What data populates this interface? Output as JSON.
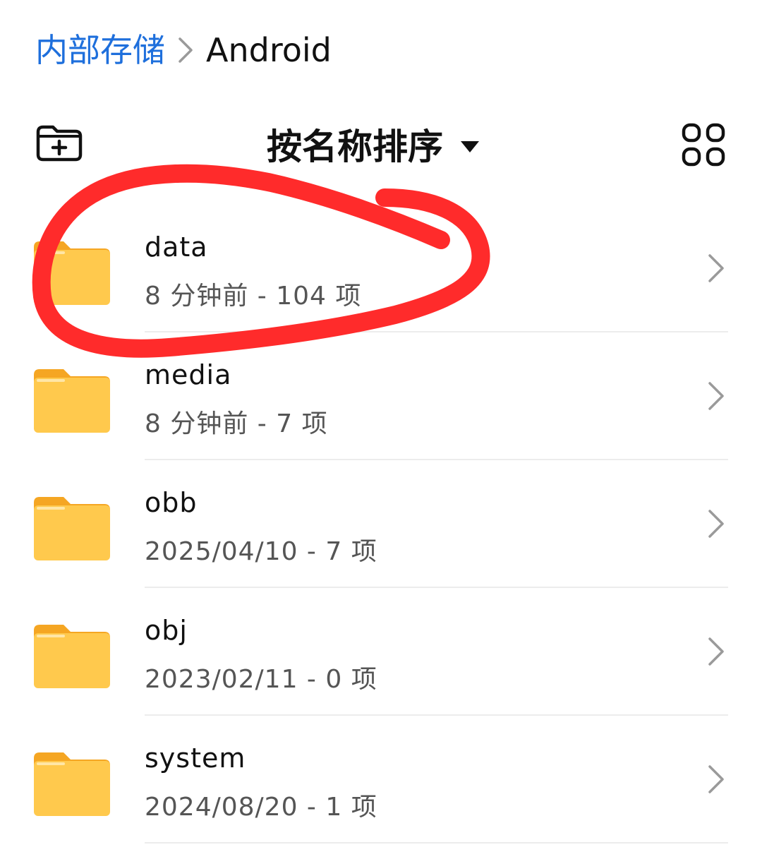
{
  "breadcrumb": {
    "root": "内部存储",
    "current": "Android"
  },
  "toolbar": {
    "sort_label": "按名称排序"
  },
  "icons": {
    "breadcrumb_separator": "chevron-right-icon",
    "new_folder": "new-folder-icon",
    "sort_dropdown": "caret-down-icon",
    "view_toggle": "grid-view-icon",
    "folder": "folder-icon",
    "row_open": "chevron-right-icon"
  },
  "colors": {
    "breadcrumb_link": "#1e6fdc",
    "folder_body": "#ffc94d",
    "folder_tab": "#f5a623",
    "annotation": "#ff2b2b"
  },
  "files": [
    {
      "name": "data",
      "meta": "8 分钟前 - 104 项"
    },
    {
      "name": "media",
      "meta": "8 分钟前 - 7 项"
    },
    {
      "name": "obb",
      "meta": "2025/04/10 - 7 项"
    },
    {
      "name": "obj",
      "meta": "2023/02/11 - 0 项"
    },
    {
      "name": "system",
      "meta": "2024/08/20 - 1 项"
    }
  ]
}
